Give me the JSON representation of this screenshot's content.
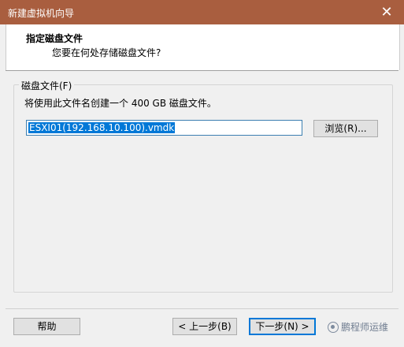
{
  "window": {
    "title": "新建虚拟机向导",
    "close_glyph": "✕"
  },
  "header": {
    "title": "指定磁盘文件",
    "subtitle": "您要在何处存储磁盘文件?"
  },
  "disk_group": {
    "legend": "磁盘文件(F)",
    "description": "将使用此文件名创建一个 400 GB 磁盘文件。",
    "file_value": "ESXI01(192.168.10.100).vmdk",
    "browse_label": "浏览(R)..."
  },
  "footer": {
    "help_label": "帮助",
    "back_label": "< 上一步(B)",
    "next_label": "下一步(N) >",
    "watermark": "鹏程师运维"
  },
  "colors": {
    "titlebar": "#a95e3f",
    "selection": "#0078d7"
  }
}
